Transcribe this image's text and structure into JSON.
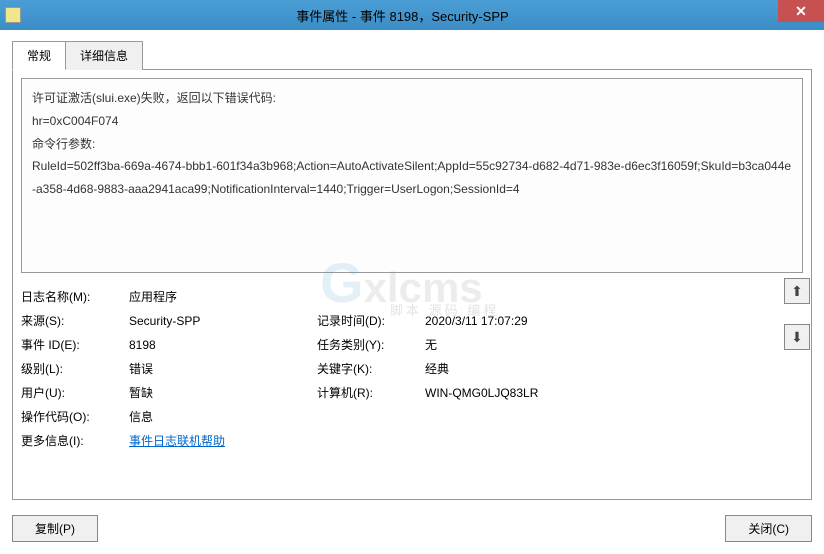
{
  "titlebar": {
    "title": "事件属性 - 事件 8198，Security-SPP"
  },
  "tabs": {
    "general": "常规",
    "details": "详细信息"
  },
  "description": {
    "line1": "许可证激活(slui.exe)失败，返回以下错误代码:",
    "line2": "hr=0xC004F074",
    "line3": "命令行参数:",
    "line4": "RuleId=502ff3ba-669a-4674-bbb1-601f34a3b968;Action=AutoActivateSilent;AppId=55c92734-d682-4d71-983e-d6ec3f16059f;SkuId=b3ca044e-a358-4d68-9883-aaa2941aca99;NotificationInterval=1440;Trigger=UserLogon;SessionId=4"
  },
  "details": {
    "logName_label": "日志名称(M):",
    "logName_value": "应用程序",
    "source_label": "来源(S):",
    "source_value": "Security-SPP",
    "logged_label": "记录时间(D):",
    "logged_value": "2020/3/11 17:07:29",
    "eventId_label": "事件 ID(E):",
    "eventId_value": "8198",
    "taskCat_label": "任务类别(Y):",
    "taskCat_value": "无",
    "level_label": "级别(L):",
    "level_value": "错误",
    "keywords_label": "关键字(K):",
    "keywords_value": "经典",
    "user_label": "用户(U):",
    "user_value": "暂缺",
    "computer_label": "计算机(R):",
    "computer_value": "WIN-QMG0LJQ83LR",
    "opcode_label": "操作代码(O):",
    "opcode_value": "信息",
    "moreInfo_label": "更多信息(I):",
    "moreInfo_link": "事件日志联机帮助"
  },
  "buttons": {
    "copy": "复制(P)",
    "close": "关闭(C)"
  },
  "watermark": {
    "brand": "xlcms",
    "sub": "脚本 源码 编程"
  }
}
